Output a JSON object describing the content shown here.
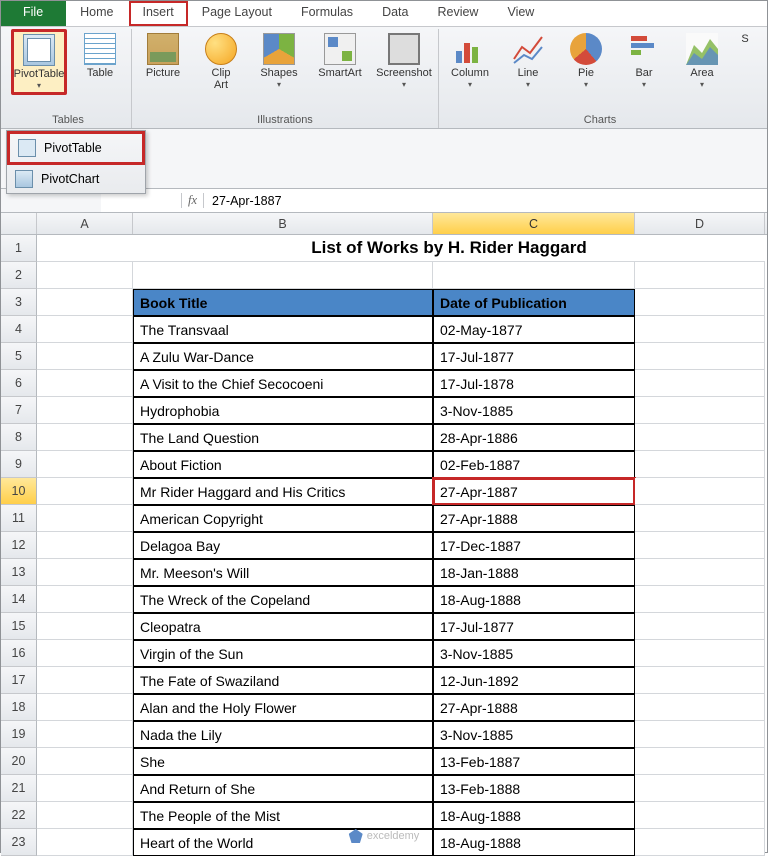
{
  "tabs": {
    "file": "File",
    "items": [
      "Home",
      "Insert",
      "Page Layout",
      "Formulas",
      "Data",
      "Review",
      "View"
    ],
    "active_highlight_index": 1
  },
  "ribbon": {
    "groups": {
      "tables": {
        "label": "Tables",
        "pivot": "PivotTable",
        "table": "Table"
      },
      "illustrations": {
        "label": "Illustrations",
        "picture": "Picture",
        "clipart": "Clip\nArt",
        "shapes": "Shapes",
        "smartart": "SmartArt",
        "screenshot": "Screenshot"
      },
      "charts": {
        "label": "Charts",
        "column": "Column",
        "line": "Line",
        "pie": "Pie",
        "bar": "Bar",
        "area": "Area",
        "scatter": "S"
      }
    }
  },
  "dropdown": {
    "pivot_table": "PivotTable",
    "pivot_chart": "PivotChart"
  },
  "formula_bar": {
    "fx_label": "fx",
    "value": "27-Apr-1887"
  },
  "columns": [
    "A",
    "B",
    "C",
    "D"
  ],
  "selected_col": "C",
  "selected_row": 10,
  "sheet": {
    "title": "List of Works by H. Rider Haggard",
    "header": {
      "col1": "Book Title",
      "col2": "Date of Publication"
    },
    "rows": [
      {
        "title": "The Transvaal",
        "date": "02-May-1877"
      },
      {
        "title": "A Zulu War-Dance",
        "date": "17-Jul-1877"
      },
      {
        "title": "A Visit to the Chief Secocoeni",
        "date": "17-Jul-1878"
      },
      {
        "title": "Hydrophobia",
        "date": "3-Nov-1885"
      },
      {
        "title": "The Land Question",
        "date": "28-Apr-1886"
      },
      {
        "title": "About Fiction",
        "date": "02-Feb-1887"
      },
      {
        "title": "Mr Rider Haggard and His Critics",
        "date": "27-Apr-1887"
      },
      {
        "title": "American Copyright",
        "date": "27-Apr-1888"
      },
      {
        "title": "Delagoa Bay",
        "date": "17-Dec-1887"
      },
      {
        "title": "Mr. Meeson's Will",
        "date": "18-Jan-1888"
      },
      {
        "title": "The Wreck of the Copeland",
        "date": "18-Aug-1888"
      },
      {
        "title": "Cleopatra",
        "date": "17-Jul-1877"
      },
      {
        "title": "Virgin of the Sun",
        "date": "3-Nov-1885"
      },
      {
        "title": "The Fate of Swaziland",
        "date": "12-Jun-1892"
      },
      {
        "title": "Alan and the Holy Flower",
        "date": "27-Apr-1888"
      },
      {
        "title": "Nada the Lily",
        "date": "3-Nov-1885"
      },
      {
        "title": "She",
        "date": "13-Feb-1887"
      },
      {
        "title": "And Return of She",
        "date": "13-Feb-1888"
      },
      {
        "title": "The People of the Mist",
        "date": "18-Aug-1888"
      },
      {
        "title": "Heart of the World",
        "date": "18-Aug-1888"
      }
    ]
  },
  "watermark": "exceldemy"
}
